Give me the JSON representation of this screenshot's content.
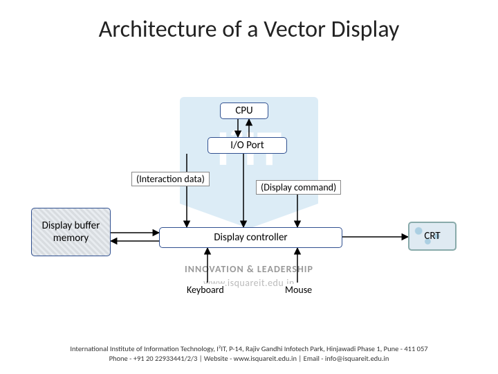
{
  "title": "Architecture of a Vector Display",
  "watermark": {
    "logo": "I²IT",
    "tagline": "INNOVATION & LEADERSHIP",
    "url": "www.isquareit.edu.in"
  },
  "nodes": {
    "cpu": "CPU",
    "io_port": "I/O Port",
    "interaction_data": "(Interaction data)",
    "display_command": "(Display command)",
    "display_buffer_memory": "Display buffer memory",
    "display_controller": "Display controller",
    "keyboard": "Keyboard",
    "mouse": "Mouse",
    "crt": "CRT"
  },
  "footer": {
    "line1": "International Institute of Information Technology, I²IT, P-14, Rajiv Gandhi Infotech Park, Hinjawadi Phase 1, Pune - 411 057",
    "line2": "Phone - +91 20 22933441/2/3 | Website - www.isquareit.edu.in | Email - info@isquareit.edu.in"
  }
}
